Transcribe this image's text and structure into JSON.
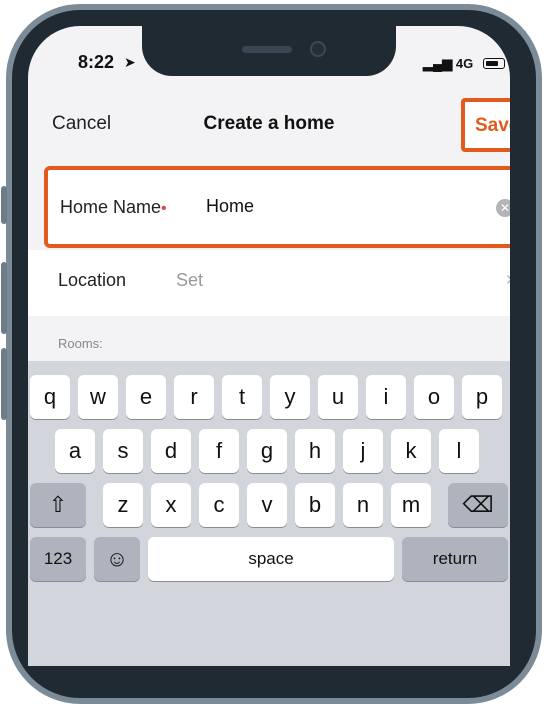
{
  "status_bar": {
    "time": "8:22",
    "signal": "4G"
  },
  "nav": {
    "cancel": "Cancel",
    "title": "Create a home",
    "save": "Save"
  },
  "home_name": {
    "label": "Home Name",
    "required_mark": "•",
    "value": "Home"
  },
  "location": {
    "label": "Location",
    "value": "Set"
  },
  "rooms": {
    "label": "Rooms:"
  },
  "keyboard": {
    "row1": [
      "q",
      "w",
      "e",
      "r",
      "t",
      "y",
      "u",
      "i",
      "o",
      "p"
    ],
    "row2": [
      "a",
      "s",
      "d",
      "f",
      "g",
      "h",
      "j",
      "k",
      "l"
    ],
    "row3": [
      "z",
      "x",
      "c",
      "v",
      "b",
      "n",
      "m"
    ],
    "numbers": "123",
    "space": "space",
    "return": "return"
  },
  "colors": {
    "accent": "#e35a1e",
    "required": "#e0464f"
  }
}
